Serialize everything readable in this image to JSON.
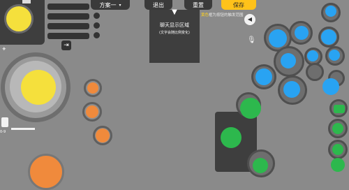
{
  "toolbar": {
    "scheme_label": "方案一",
    "exit_label": "退出",
    "reset_label": "重置",
    "save_label": "保存"
  },
  "hint": {
    "highlight": "黄色",
    "text": "框为按钮的触发范围"
  },
  "chat_area": {
    "title": "聊天显示区域",
    "subtitle": "(文字会随比例变化)"
  },
  "slider_label": "0-9",
  "colors": {
    "background": "#8a8a8a",
    "panel": "#3e3e3e",
    "orange": "#f08a3c",
    "blue": "#29a3f2",
    "green": "#2db84d",
    "yellow": "#f5e03c",
    "save_button": "#ffc21a"
  },
  "icons": [
    "chevron-down-icon",
    "chevron-up-icon",
    "triangle-down-icon",
    "speaker-icon",
    "mic-icon",
    "exit-icon",
    "running-man-icon",
    "device-icon",
    "close-icon"
  ]
}
